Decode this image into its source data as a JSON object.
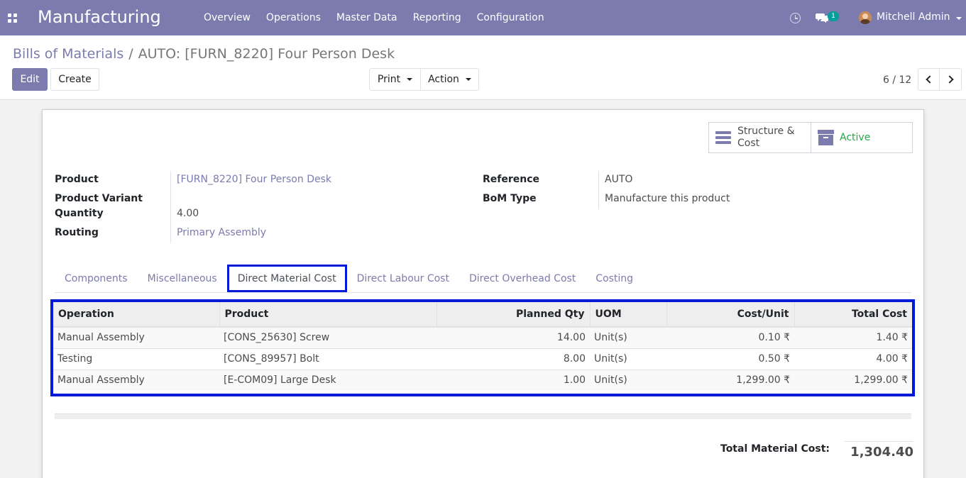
{
  "navbar": {
    "app_title": "Manufacturing",
    "menu": [
      "Overview",
      "Operations",
      "Master Data",
      "Reporting",
      "Configuration"
    ],
    "chat_badge": "1",
    "user_name": "Mitchell Admin"
  },
  "breadcrumb": {
    "parent": "Bills of Materials",
    "separator": "/",
    "current": "AUTO: [FURN_8220] Four Person Desk"
  },
  "buttons": {
    "edit": "Edit",
    "create": "Create",
    "print": "Print",
    "action": "Action"
  },
  "pager": {
    "value": "6 / 12"
  },
  "smart_buttons": {
    "structure_cost": "Structure & Cost",
    "active": "Active",
    "active_color": "#28a745"
  },
  "fields": {
    "product_label": "Product",
    "product_value": "[FURN_8220] Four Person Desk",
    "variant_label": "Product Variant",
    "quantity_label": "Quantity",
    "quantity_value": "4.00",
    "routing_label": "Routing",
    "routing_value": "Primary Assembly",
    "reference_label": "Reference",
    "reference_value": "AUTO",
    "bom_type_label": "BoM Type",
    "bom_type_value": "Manufacture this product"
  },
  "tabs": [
    "Components",
    "Miscellaneous",
    "Direct Material Cost",
    "Direct Labour Cost",
    "Direct Overhead Cost",
    "Costing"
  ],
  "active_tab": "Direct Material Cost",
  "table": {
    "headers": [
      "Operation",
      "Product",
      "Planned Qty",
      "UOM",
      "Cost/Unit",
      "Total Cost"
    ],
    "rows": [
      [
        "Manual Assembly",
        "[CONS_25630] Screw",
        "14.00",
        "Unit(s)",
        "0.10 ₹",
        "1.40 ₹"
      ],
      [
        "Testing",
        "[CONS_89957] Bolt",
        "8.00",
        "Unit(s)",
        "0.50 ₹",
        "4.00 ₹"
      ],
      [
        "Manual Assembly",
        "[E-COM09] Large Desk",
        "1.00",
        "Unit(s)",
        "1,299.00 ₹",
        "1,299.00 ₹"
      ]
    ]
  },
  "totals": {
    "label": "Total Material Cost:",
    "value": "1,304.40"
  },
  "colors": {
    "brand": "#7c7bad",
    "highlight": "#0018d8"
  }
}
